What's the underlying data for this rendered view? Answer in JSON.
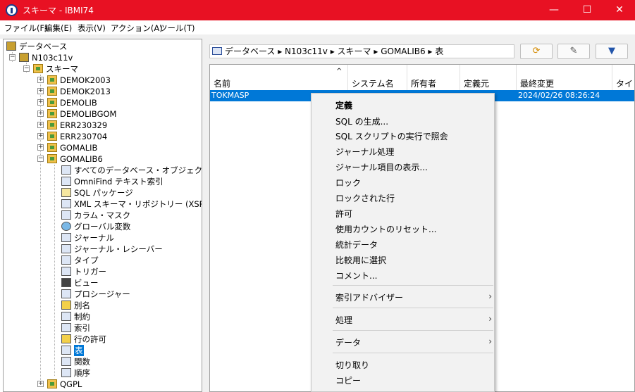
{
  "window": {
    "title": "スキーマ - IBMI74"
  },
  "window_controls": {
    "minimize": "—",
    "maximize": "☐",
    "close": "✕"
  },
  "menu": [
    "ファイル(F)",
    "編集(E)",
    "表示(V)",
    "アクション(A)",
    "ツール(T)"
  ],
  "tree": {
    "root": "データベース",
    "system": "N103c11v",
    "schemas_folder": "スキーマ",
    "schemas": [
      "DEMOK2003",
      "DEMOK2013",
      "DEMOLIB",
      "DEMOLIBGOM",
      "ERR230329",
      "ERR230704",
      "GOMALIB",
      "GOMALIB6"
    ],
    "objects": [
      "すべてのデータベース・オブジェクト",
      "OmniFind テキスト索引",
      "SQL パッケージ",
      "XML スキーマ・リポジトリー (XSR)",
      "カラム・マスク",
      "グローバル変数",
      "ジャーナル",
      "ジャーナル・レシーバー",
      "タイプ",
      "トリガー",
      "ビュー",
      "プロシージャー",
      "別名",
      "制約",
      "索引",
      "行の許可",
      "表",
      "関数",
      "順序"
    ],
    "selected": "表",
    "last_schema": "QGPL"
  },
  "path": {
    "text": "データベース ▸ N103c11v ▸ スキーマ ▸ GOMALIB6 ▸ 表"
  },
  "toolbar": {
    "refresh_icon": "⟳",
    "edit_icon": "✎",
    "filter_icon": "▼"
  },
  "columns": [
    "名前",
    "システム名",
    "所有者",
    "定義元",
    "最終変更",
    "タイ"
  ],
  "sort_indicator": "^",
  "rows": [
    {
      "name": "TOKMASP",
      "modified": "2024/02/26 08:26:24"
    }
  ],
  "context_menu": {
    "items": [
      "定義",
      "SQL の生成...",
      "SQL スクリプトの実行で照会",
      "ジャーナル処理",
      "ジャーナル項目の表示...",
      "ロック",
      "ロックされた行",
      "許可",
      "使用カウントのリセット...",
      "統計データ",
      "比較用に選択",
      "コメント..."
    ],
    "submenus": [
      "索引アドバイザー",
      "処理",
      "データ"
    ],
    "tail": [
      "切り取り",
      "コピー"
    ],
    "submenu_arrow": "›"
  },
  "colors": {
    "titlebar": "#e81123",
    "selection": "#0078d7"
  }
}
